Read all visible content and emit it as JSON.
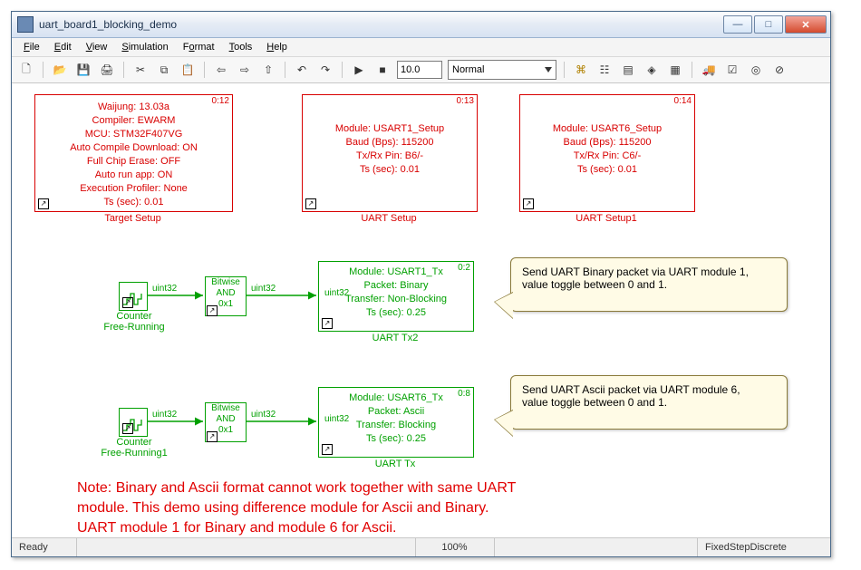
{
  "window": {
    "title": "uart_board1_blocking_demo"
  },
  "menu": {
    "file": "File",
    "edit": "Edit",
    "view": "View",
    "simulation": "Simulation",
    "format": "Format",
    "tools": "Tools",
    "help": "Help"
  },
  "toolbar": {
    "time": "10.0",
    "mode": "Normal"
  },
  "blocks": {
    "target": {
      "tag": "0:12",
      "l1": "Waijung: 13.03a",
      "l2": "Compiler: EWARM",
      "l3": "MCU: STM32F407VG",
      "l4": "Auto Compile Download: ON",
      "l5": "Full Chip Erase: OFF",
      "l6": "Auto run app: ON",
      "l7": "Execution Profiler: None",
      "l8": "Ts (sec): 0.01",
      "name": "Target Setup"
    },
    "uart1": {
      "tag": "0:13",
      "l1": "Module: USART1_Setup",
      "l2": "Baud (Bps): 115200",
      "l3": "Tx/Rx Pin: B6/-",
      "l4": "Ts (sec): 0.01",
      "name": "UART Setup"
    },
    "uart6": {
      "tag": "0:14",
      "l1": "Module: USART6_Setup",
      "l2": "Baud (Bps): 115200",
      "l3": "Tx/Rx Pin: C6/-",
      "l4": "Ts (sec): 0.01",
      "name": "UART Setup1"
    },
    "counter_a": "Counter\nFree-Running",
    "counter_b": "Counter\nFree-Running1",
    "bitand": "Bitwise\nAND\n0x1",
    "sig": "uint32",
    "tx2": {
      "tag": "0:2",
      "l1": "Module: USART1_Tx",
      "l2": "Packet: Binary",
      "l3": "Transfer: Non-Blocking",
      "l4": "Ts (sec): 0.25",
      "name": "UART Tx2"
    },
    "tx": {
      "tag": "0:8",
      "l1": "Module: USART6_Tx",
      "l2": "Packet: Ascii",
      "l3": "Transfer: Blocking",
      "l4": "Ts (sec): 0.25",
      "name": "UART Tx"
    }
  },
  "callouts": {
    "c1": "Send UART Binary packet via UART module 1,\nvalue toggle between  0 and 1.",
    "c2": "Send UART Ascii packet via UART module 6,\nvalue toggle between  0 and 1."
  },
  "note": "Note: Binary and Ascii format cannot work together with same UART\nmodule. This demo using difference module for Ascii and Binary.\nUART module 1 for Binary and module 6 for Ascii.",
  "status": {
    "left": "Ready",
    "zoom": "100%",
    "solver": "FixedStepDiscrete"
  }
}
